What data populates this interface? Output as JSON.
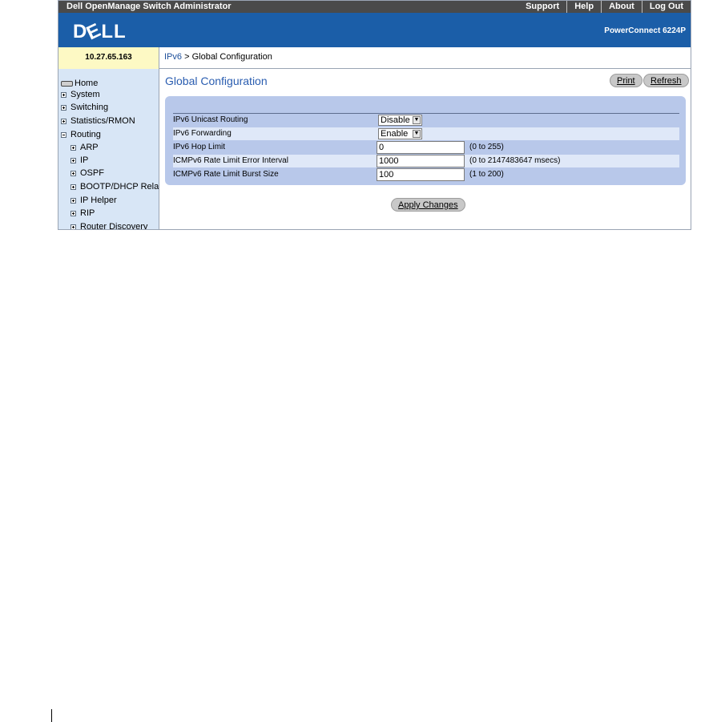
{
  "topbar": {
    "title": "Dell OpenManage Switch Administrator",
    "links": {
      "support": "Support",
      "help": "Help",
      "about": "About",
      "logout": "Log Out"
    }
  },
  "banner": {
    "logo": "DELL",
    "model": "PowerConnect 6224P"
  },
  "ip_address": "10.27.65.163",
  "breadcrumb": {
    "parent": "IPv6",
    "separator": ">",
    "current": "Global Configuration"
  },
  "sidebar": {
    "home": "Home",
    "system": "System",
    "switching": "Switching",
    "statistics": "Statistics/RMON",
    "routing": "Routing",
    "routing_children": {
      "arp": "ARP",
      "ip": "IP",
      "ospf": "OSPF",
      "bootp": "BOOTP/DHCP Relay A",
      "iphelper": "IP Helper",
      "rip": "RIP",
      "router_discovery": "Router Discovery"
    }
  },
  "page": {
    "title": "Global Configuration",
    "print": "Print",
    "refresh": "Refresh",
    "apply": "Apply Changes"
  },
  "form": {
    "unicast_routing": {
      "label": "IPv6 Unicast Routing",
      "value": "Disable"
    },
    "forwarding": {
      "label": "IPv6 Forwarding",
      "value": "Enable"
    },
    "hop_limit": {
      "label": "IPv6 Hop Limit",
      "value": "0",
      "range": "(0 to 255)"
    },
    "error_interval": {
      "label": "ICMPv6 Rate Limit Error Interval",
      "value": "1000",
      "range": "(0 to 2147483647 msecs)"
    },
    "burst_size": {
      "label": "ICMPv6 Rate Limit Burst Size",
      "value": "100",
      "range": "(1 to 200)"
    }
  },
  "colors": {
    "banner_blue": "#1b5ea8",
    "topbar_gray": "#4a4a4a",
    "panel_blue": "#b8c8ea",
    "title_blue": "#2a5db0",
    "ip_yellow": "#fdf9c4"
  }
}
